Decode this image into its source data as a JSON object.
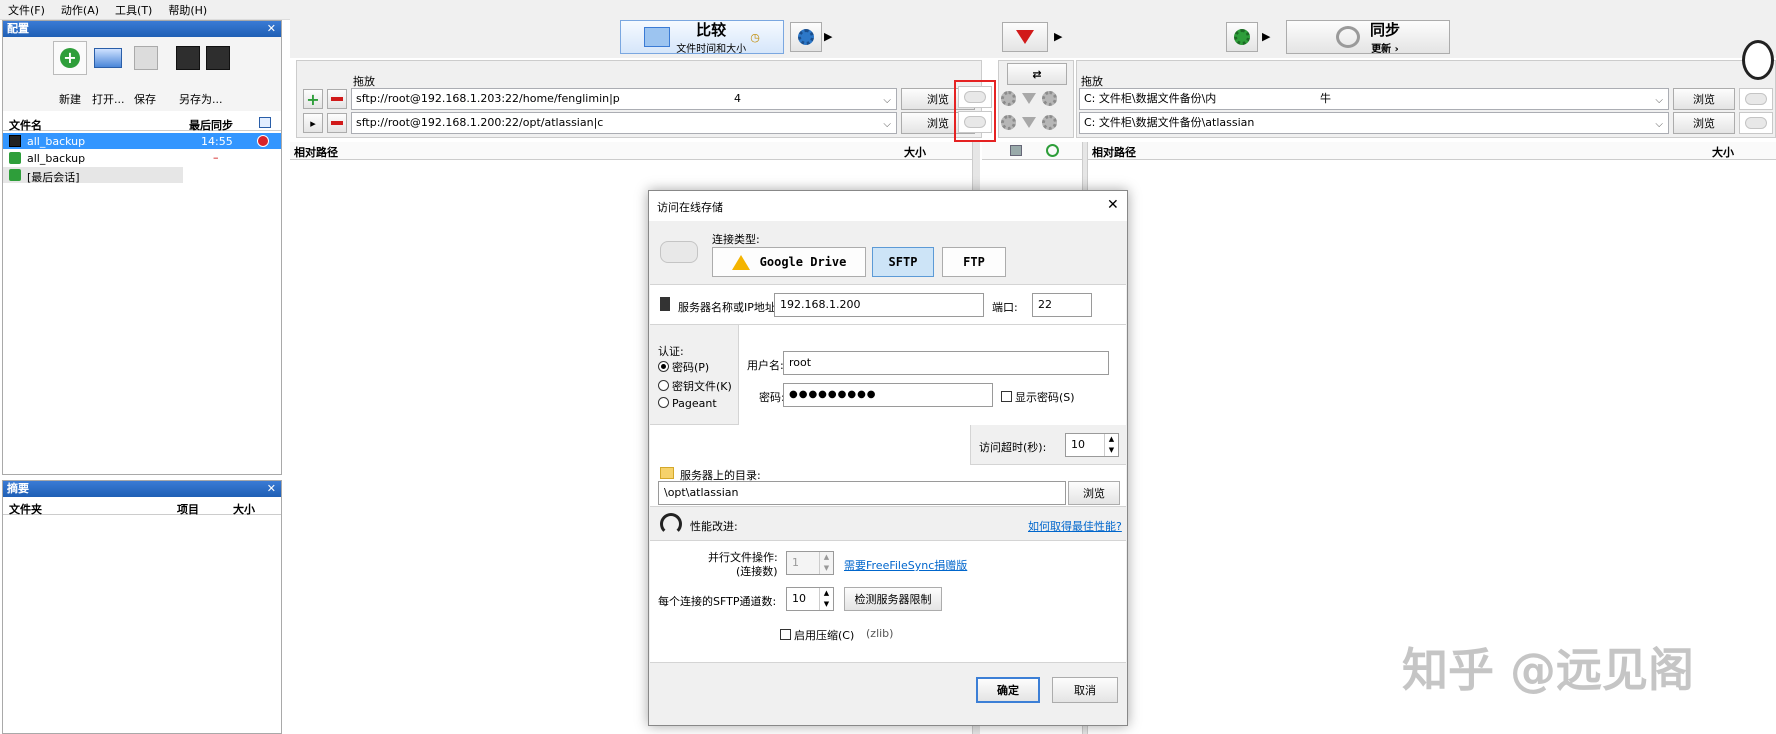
{
  "menu": [
    "文件(F)",
    "动作(A)",
    "工具(T)",
    "帮助(H)"
  ],
  "config_panel": {
    "title": "配置",
    "buttons": {
      "new": "新建",
      "open": "打开...",
      "save": "保存",
      "saveas": "另存为..."
    },
    "col_name": "文件名",
    "col_sync": "最后同步",
    "items": [
      {
        "name": "all_backup",
        "time": "14:55"
      },
      {
        "name": "all_backup",
        "time": "–"
      },
      {
        "name": "[最后会话]",
        "time": ""
      }
    ]
  },
  "summary_panel": {
    "title": "摘要",
    "col_folder": "文件夹",
    "col_items": "项目",
    "col_size": "大小"
  },
  "toolbar": {
    "compare_label": "比较",
    "compare_sub": "文件时间和大小",
    "sync_label": "同步",
    "sync_sub": "更新 ›"
  },
  "left_pane": {
    "drop_label": "拖放",
    "path1": "sftp://root@192.168.1.203:22/home/fenglimin|p",
    "path1_tail": "4",
    "path2": "sftp://root@192.168.1.200:22/opt/atlassian|c",
    "browse": "浏览",
    "col_path": "相对路径",
    "col_size": "大小"
  },
  "right_pane": {
    "drop_label": "拖放",
    "path1": "C:      文件柜\\数据文件备份\\内",
    "path1_tail": "牛",
    "path2": "C:      文件柜\\数据文件备份\\atlassian",
    "browse": "浏览",
    "col_path": "相对路径",
    "col_size": "大小"
  },
  "dialog": {
    "title": "访问在线存储",
    "conn_type_label": "连接类型:",
    "types": [
      "Google Drive",
      "SFTP",
      "FTP"
    ],
    "server_label": "服务器名称或IP地址:",
    "server_value": "192.168.1.200",
    "port_label": "端口:",
    "port_value": "22",
    "auth_label": "认证:",
    "auth_options": [
      "密码(P)",
      "密钥文件(K)",
      "Pageant"
    ],
    "user_label": "用户名:",
    "user_value": "root",
    "pass_label": "密码:",
    "pass_value": "●●●●●●●●●",
    "show_pass": "显示密码(S)",
    "timeout_label": "访问超时(秒):",
    "timeout_value": "10",
    "dir_label": "服务器上的目录:",
    "dir_value": "\\opt\\atlassian",
    "dir_browse": "浏览",
    "perf_label": "性能改进:",
    "perf_link": "如何取得最佳性能?",
    "parallel_label": "并行文件操作:",
    "parallel_sub": "(连接数)",
    "parallel_value": "1",
    "donation_link": "需要FreeFileSync捐赠版",
    "channels_label": "每个连接的SFTP通道数:",
    "channels_value": "10",
    "detect_btn": "检测服务器限制",
    "compress_label": "启用压缩(C)",
    "compress_note": "(zlib)",
    "ok": "确定",
    "cancel": "取消"
  },
  "watermark": "知乎 @远见阁"
}
